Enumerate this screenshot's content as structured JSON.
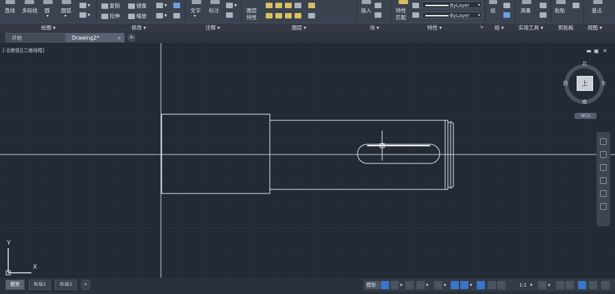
{
  "ribbon": {
    "draw": {
      "line": "直线",
      "polyline": "多段线",
      "circle": "圆",
      "arc": "圆弧",
      "panel": "绘图"
    },
    "modify": {
      "copy": "复制",
      "mirror": "镜像",
      "stretch": "拉伸",
      "scale": "缩放",
      "panel": "修改"
    },
    "annotation": {
      "text": "文字",
      "dimension": "标注",
      "panel": "注释"
    },
    "layers": {
      "layer_props": "图层",
      "layer_props2": "特性",
      "panel": "图层"
    },
    "block": {
      "insert": "插入",
      "panel": "块"
    },
    "properties": {
      "match": "特性",
      "match2": "匹配",
      "bylayer1": "ByLayer",
      "bylayer2": "ByLayer",
      "panel": "特性"
    },
    "groups": {
      "group": "组",
      "panel": "组"
    },
    "utilities": {
      "measure": "测量",
      "panel": "实用工具"
    },
    "clipboard": {
      "paste": "粘贴",
      "panel": "剪贴板"
    },
    "view": {
      "base": "基点",
      "panel": "视图"
    }
  },
  "file_tabs": {
    "start": "开始",
    "drawing": "Drawing2*",
    "close": "×",
    "new": "+"
  },
  "viewport": {
    "label": "[-][俯视][二维线框]",
    "controls": [
      "▬",
      "▣",
      "✕"
    ],
    "viewcube": {
      "top": "上",
      "north": "北",
      "south": "南",
      "east": "东",
      "west": "西",
      "wcs": "WCS"
    },
    "ucs": {
      "y": "Y",
      "x": "X"
    }
  },
  "layout_tabs": {
    "model": "模型",
    "layout1": "布局1",
    "layout2": "布局2",
    "new": "+"
  },
  "status": {
    "model": "模型",
    "scale": "1:1"
  },
  "colors": {
    "background": "#222a35",
    "geometry": "#e8ecf1",
    "accent": "#3b74c8"
  }
}
